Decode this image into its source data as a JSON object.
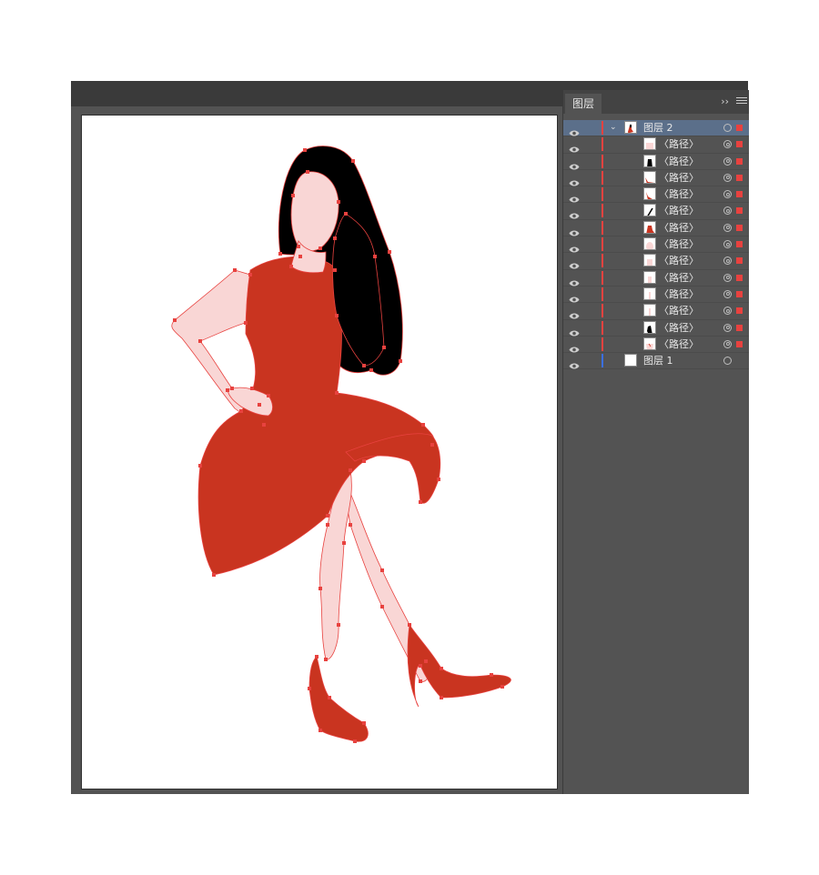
{
  "panel": {
    "tab_label": "图层",
    "collapse_glyph": "››"
  },
  "layers": [
    {
      "name": "图层 2",
      "type": "layer",
      "expanded": true,
      "selected": true,
      "color": "#e8423f",
      "thumb": "figure"
    },
    {
      "name": "〈路径〉",
      "type": "path",
      "thumb": "pink-skin"
    },
    {
      "name": "〈路径〉",
      "type": "path",
      "thumb": "black-hair"
    },
    {
      "name": "〈路径〉",
      "type": "path",
      "thumb": "red-shoe"
    },
    {
      "name": "〈路径〉",
      "type": "path",
      "thumb": "red-shoe-2"
    },
    {
      "name": "〈路径〉",
      "type": "path",
      "thumb": "black-stroke"
    },
    {
      "name": "〈路径〉",
      "type": "path",
      "thumb": "red-dress"
    },
    {
      "name": "〈路径〉",
      "type": "path",
      "thumb": "pink-face"
    },
    {
      "name": "〈路径〉",
      "type": "path",
      "thumb": "pink-arm"
    },
    {
      "name": "〈路径〉",
      "type": "path",
      "thumb": "pink-hand"
    },
    {
      "name": "〈路径〉",
      "type": "path",
      "thumb": "pink-leg"
    },
    {
      "name": "〈路径〉",
      "type": "path",
      "thumb": "pink-leg-2"
    },
    {
      "name": "〈路径〉",
      "type": "path",
      "thumb": "black-hair-2"
    },
    {
      "name": "〈路径〉",
      "type": "path",
      "thumb": "pink-neck"
    },
    {
      "name": "图层 1",
      "type": "layer",
      "expanded": false,
      "selected": false,
      "color": "#3b6fe0",
      "thumb": "blank"
    }
  ],
  "colors": {
    "dress": "#c93420",
    "skin": "#f9d6d5",
    "hair": "#000000",
    "anchor": "#e8423f",
    "layer2": "#e8423f",
    "layer1": "#3b6fe0"
  }
}
